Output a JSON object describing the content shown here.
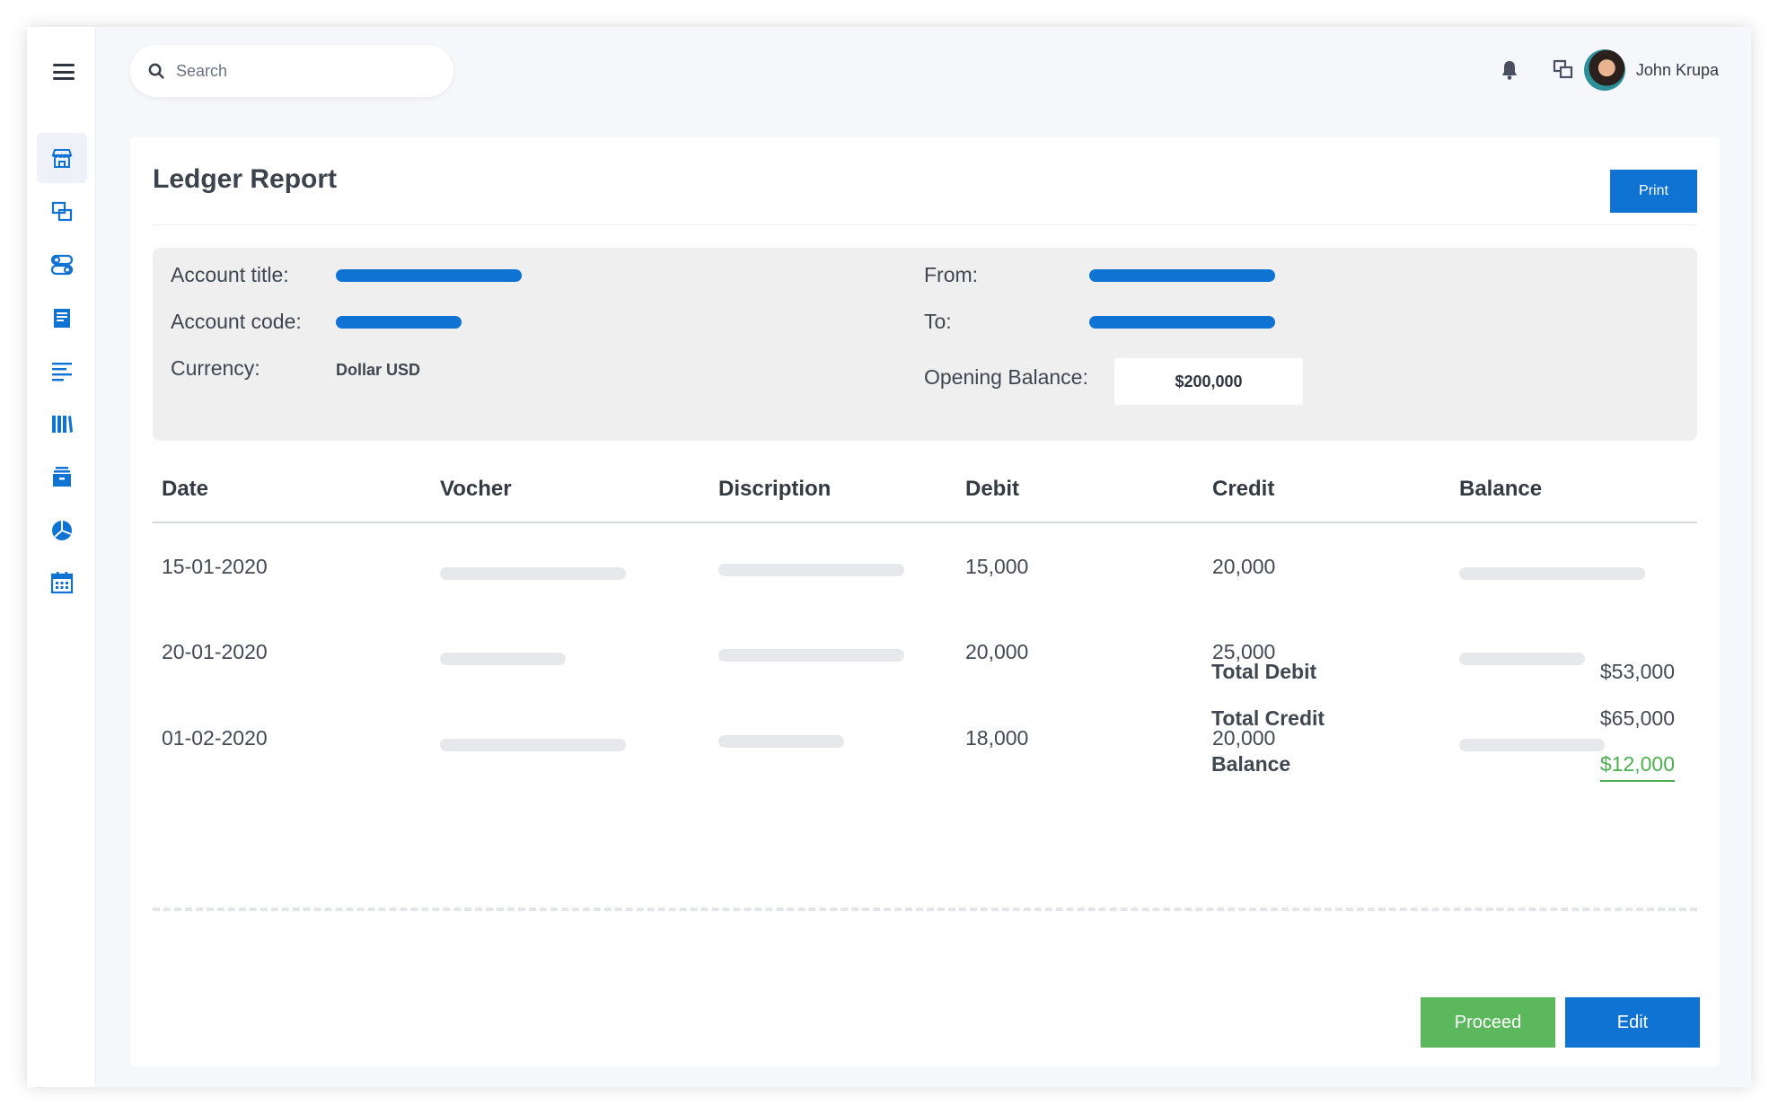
{
  "search": {
    "placeholder": "Search"
  },
  "user": {
    "name": "John Krupa"
  },
  "sidebar": {
    "items": [
      {
        "icon": "store-icon",
        "active": true
      },
      {
        "icon": "copy-windows-icon"
      },
      {
        "icon": "toggles-icon"
      },
      {
        "icon": "document-icon"
      },
      {
        "icon": "text-lines-icon"
      },
      {
        "icon": "books-icon"
      },
      {
        "icon": "archive-icon"
      },
      {
        "icon": "pie-chart-icon"
      },
      {
        "icon": "calendar-icon"
      }
    ]
  },
  "page": {
    "title": "Ledger Report",
    "print_label": "Print"
  },
  "info": {
    "account_title_label": "Account title:",
    "account_code_label": "Account code:",
    "currency_label": "Currency:",
    "currency_value": "Dollar USD",
    "from_label": "From:",
    "to_label": "To:",
    "opening_balance_label": "Opening Balance:",
    "opening_balance_value": "$200,000"
  },
  "table": {
    "headers": [
      "Date",
      "Vocher",
      "Discription",
      "Debit",
      "Credit",
      "Balance"
    ],
    "rows": [
      {
        "date": "15-01-2020",
        "debit": "15,000",
        "credit": "20,000"
      },
      {
        "date": "20-01-2020",
        "debit": "20,000",
        "credit": "25,000"
      },
      {
        "date": "01-02-2020",
        "debit": "18,000",
        "credit": "20,000"
      }
    ]
  },
  "totals": {
    "total_debit_label": "Total Debit",
    "total_debit_value": "$53,000",
    "total_credit_label": "Total Credit",
    "total_credit_value": "$65,000",
    "balance_label": "Balance",
    "balance_value": "$12,000"
  },
  "actions": {
    "proceed_label": "Proceed",
    "edit_label": "Edit"
  },
  "colors": {
    "primary": "#0f73d4",
    "success": "#5cb85c",
    "balance_green": "#4caf50"
  }
}
